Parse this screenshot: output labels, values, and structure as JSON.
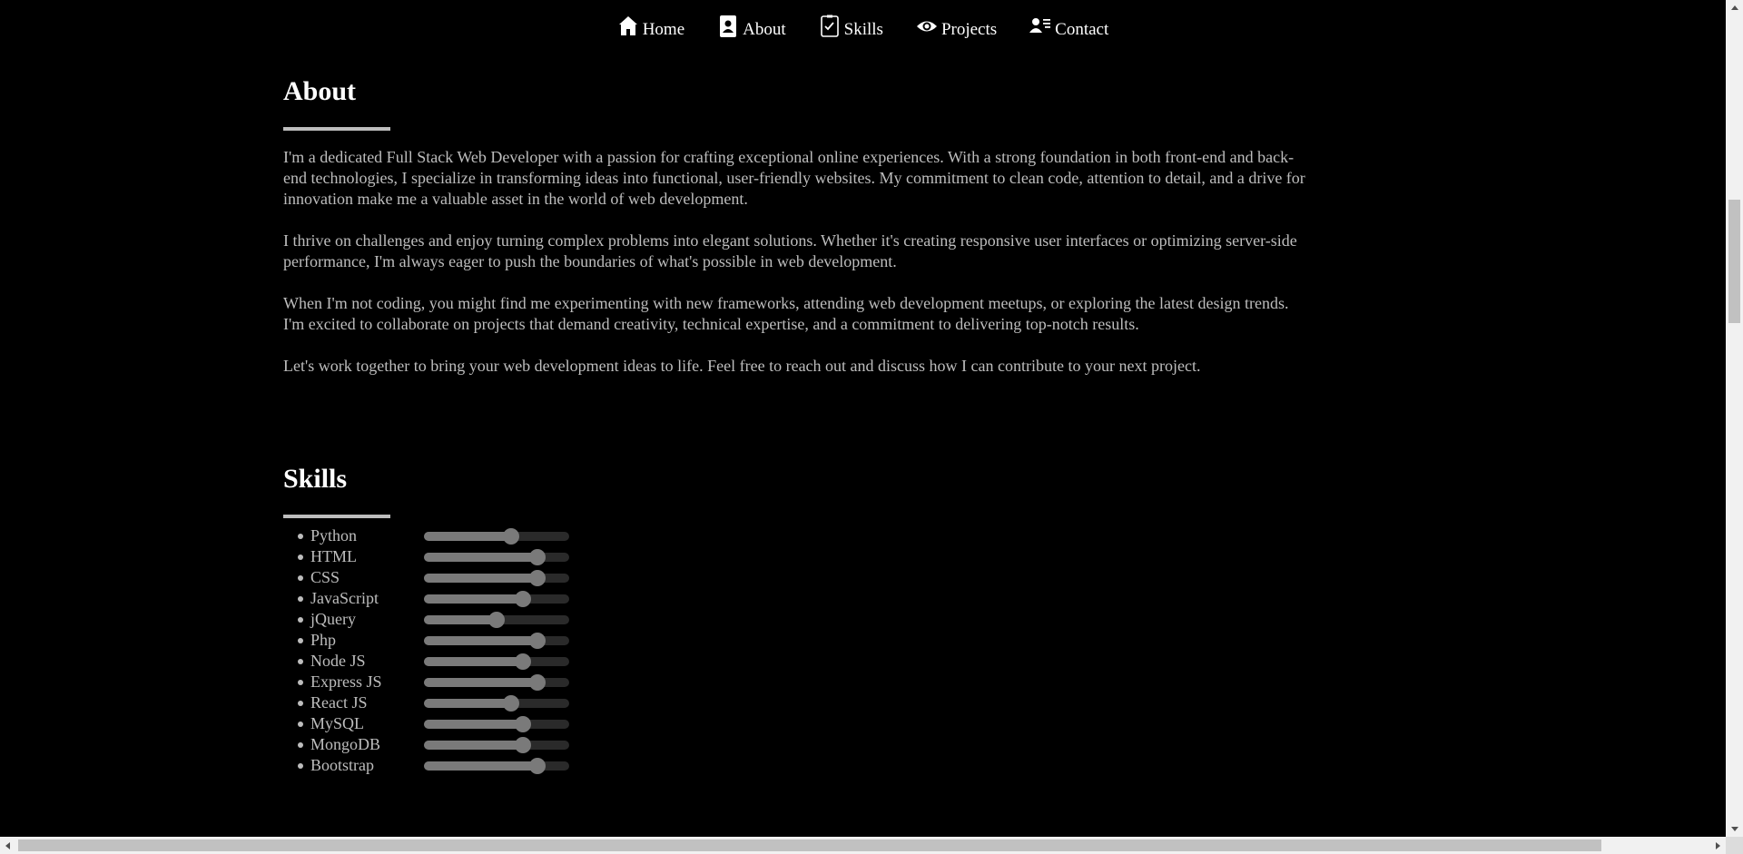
{
  "nav": {
    "items": [
      {
        "label": "Home",
        "icon": "home-icon"
      },
      {
        "label": "About",
        "icon": "contact-card-icon"
      },
      {
        "label": "Skills",
        "icon": "checklist-icon"
      },
      {
        "label": "Projects",
        "icon": "eye-icon"
      },
      {
        "label": "Contact",
        "icon": "person-lines-icon"
      }
    ]
  },
  "about": {
    "title": "About",
    "paragraphs": [
      "I'm a dedicated Full Stack Web Developer with a passion for crafting exceptional online experiences. With a strong foundation in both front-end and back-end technologies, I specialize in transforming ideas into functional, user-friendly websites. My commitment to clean code, attention to detail, and a drive for innovation make me a valuable asset in the world of web development.",
      "I thrive on challenges and enjoy turning complex problems into elegant solutions. Whether it's creating responsive user interfaces or optimizing server-side performance, I'm always eager to push the boundaries of what's possible in web development.",
      "When I'm not coding, you might find me experimenting with new frameworks, attending web development meetups, or exploring the latest design trends. I'm excited to collaborate on projects that demand creativity, technical expertise, and a commitment to delivering top-notch results.",
      "Let's work together to bring your web development ideas to life. Feel free to reach out and discuss how I can contribute to your next project."
    ]
  },
  "skills": {
    "title": "Skills",
    "items": [
      {
        "name": "Python",
        "level": 0.6
      },
      {
        "name": "HTML",
        "level": 0.78
      },
      {
        "name": "CSS",
        "level": 0.78
      },
      {
        "name": "JavaScript",
        "level": 0.68
      },
      {
        "name": "jQuery",
        "level": 0.5
      },
      {
        "name": "Php",
        "level": 0.78
      },
      {
        "name": "Node JS",
        "level": 0.68
      },
      {
        "name": "Express JS",
        "level": 0.78
      },
      {
        "name": "React JS",
        "level": 0.6
      },
      {
        "name": "MySQL",
        "level": 0.68
      },
      {
        "name": "MongoDB",
        "level": 0.68
      },
      {
        "name": "Bootstrap",
        "level": 0.78
      }
    ]
  },
  "colors": {
    "background": "#000000",
    "text": "#bdbdbd",
    "heading": "#ffffff",
    "slider": "#7a7a7a",
    "track": "#2a2a2a"
  }
}
